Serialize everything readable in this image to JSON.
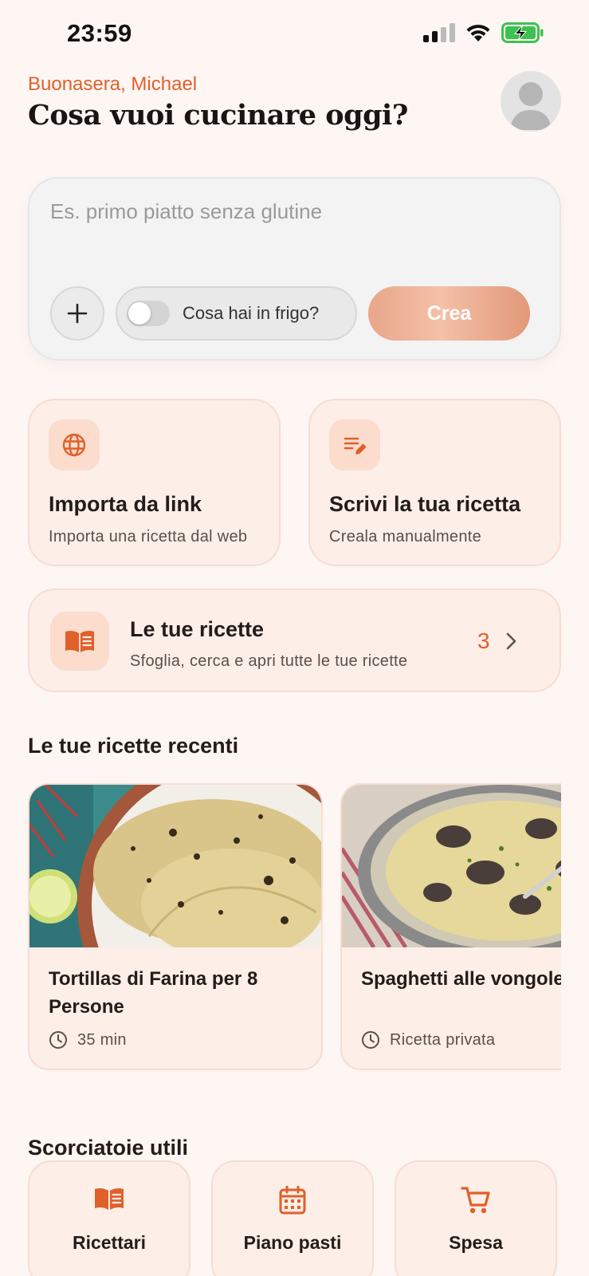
{
  "status_bar": {
    "time": "23:59"
  },
  "header": {
    "greeting": "Buonasera, Michael",
    "title": "Cosa vuoi cucinare oggi?"
  },
  "prompt": {
    "placeholder": "Es. primo piatto senza glutine",
    "fridge_label": "Cosa hai in frigo?",
    "fridge_enabled": false,
    "create_label": "Crea"
  },
  "actions": [
    {
      "title": "Importa da link",
      "subtitle": "Importa una ricetta dal web",
      "icon": "globe-icon"
    },
    {
      "title": "Scrivi la tua ricetta",
      "subtitle": "Creala manualmente",
      "icon": "edit-note-icon"
    }
  ],
  "my_recipes": {
    "title": "Le tue ricette",
    "subtitle": "Sfoglia, cerca e apri tutte le tue ricette",
    "count": "3",
    "icon": "open-book-icon"
  },
  "recent": {
    "title": "Le tue ricette recenti",
    "items": [
      {
        "title": "Tortillas di Farina per 8 Persone",
        "meta": "35 min",
        "meta_icon": "clock-icon"
      },
      {
        "title": "Spaghetti alle vongole",
        "meta": "Ricetta privata",
        "meta_icon": "clock-icon"
      }
    ]
  },
  "shortcuts": {
    "title": "Scorciatoie utili",
    "items": [
      {
        "label": "Ricettari",
        "icon": "book-icon"
      },
      {
        "label": "Piano pasti",
        "icon": "calendar-icon"
      },
      {
        "label": "Spesa",
        "icon": "cart-icon"
      }
    ]
  },
  "colors": {
    "accent": "#e0602a",
    "background": "#fdf6f3",
    "card": "#fdeee8"
  }
}
